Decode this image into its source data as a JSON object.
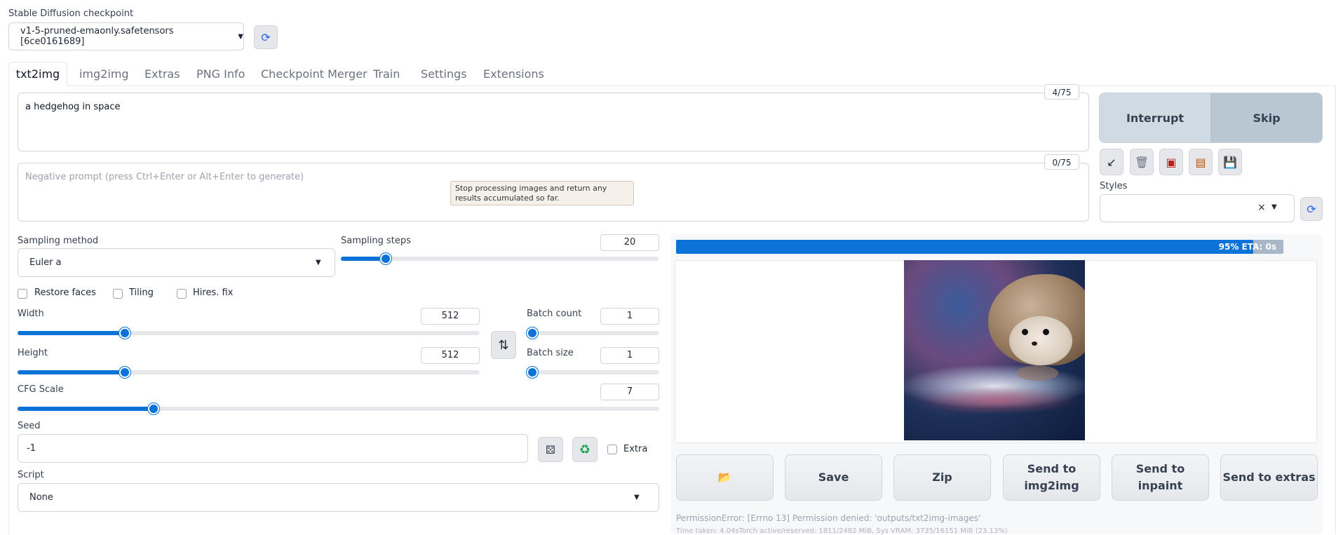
{
  "checkpoint": {
    "label": "Stable Diffusion checkpoint",
    "value": "v1-5-pruned-emaonly.safetensors [6ce0161689]"
  },
  "tabs": [
    "txt2img",
    "img2img",
    "Extras",
    "PNG Info",
    "Checkpoint Merger",
    "Train",
    "Settings",
    "Extensions"
  ],
  "prompt": {
    "value": "a hedgehog in space",
    "counter": "4/75"
  },
  "negative_prompt": {
    "placeholder": "Negative prompt (press Ctrl+Enter or Alt+Enter to generate)",
    "counter": "0/75"
  },
  "tooltip": "Stop processing images and return any results accumulated so far.",
  "actions": {
    "interrupt": "Interrupt",
    "skip": "Skip"
  },
  "styles": {
    "label": "Styles",
    "clear": "×"
  },
  "sampling": {
    "method_label": "Sampling method",
    "method_value": "Euler a",
    "steps_label": "Sampling steps",
    "steps_value": "20"
  },
  "checkboxes": {
    "restore_faces": "Restore faces",
    "tiling": "Tiling",
    "hires_fix": "Hires. fix"
  },
  "width": {
    "label": "Width",
    "value": "512"
  },
  "height": {
    "label": "Height",
    "value": "512"
  },
  "batch_count": {
    "label": "Batch count",
    "value": "1"
  },
  "batch_size": {
    "label": "Batch size",
    "value": "1"
  },
  "cfg": {
    "label": "CFG Scale",
    "value": "7"
  },
  "seed": {
    "label": "Seed",
    "value": "-1",
    "extra": "Extra"
  },
  "script": {
    "label": "Script",
    "value": "None"
  },
  "progress": {
    "text": "95% ETA: 0s",
    "fraction": 0.95
  },
  "output_buttons": {
    "save": "Save",
    "zip": "Zip",
    "send_img2img": "Send to img2img",
    "send_inpaint": "Send to inpaint",
    "send_extras": "Send to extras"
  },
  "status": {
    "error": "PermissionError: [Errno 13] Permission denied: 'outputs/txt2img-images'",
    "timing": "Time taken: 4.04sTorch active/reserved: 1811/2482 MiB, Sys VRAM: 3735/16151 MiB (23.13%)"
  },
  "icons": [
    "refresh-icon",
    "arrow-down-left-icon",
    "trash-icon",
    "card-icon",
    "clipboard-icon",
    "save-icon",
    "swap-icon",
    "dice-icon",
    "recycle-icon",
    "folder-icon",
    "chevron-down-icon"
  ]
}
